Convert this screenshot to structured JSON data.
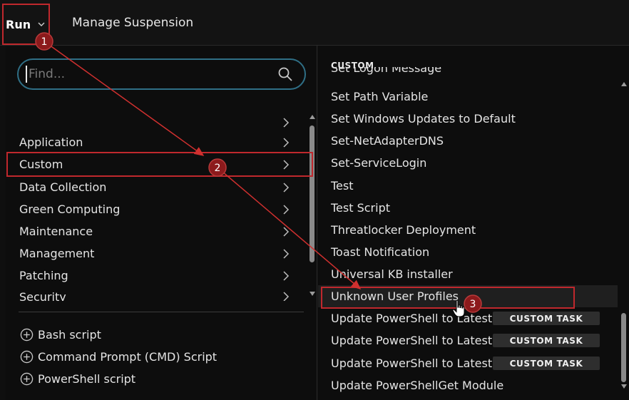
{
  "topbar": {
    "run_label": "Run",
    "run_chevron_icon": "chevron-down-icon",
    "manage_label": "Manage Suspension"
  },
  "search": {
    "placeholder": "Find...",
    "value": "",
    "icon": "search-icon"
  },
  "categories": [
    {
      "label": "",
      "icon": "chevron-right-icon"
    },
    {
      "label": "Application",
      "icon": "chevron-right-icon"
    },
    {
      "label": "Custom",
      "icon": "chevron-right-icon",
      "selected": true
    },
    {
      "label": "Data Collection",
      "icon": "chevron-right-icon"
    },
    {
      "label": "Green Computing",
      "icon": "chevron-right-icon"
    },
    {
      "label": "Maintenance",
      "icon": "chevron-right-icon"
    },
    {
      "label": "Management",
      "icon": "chevron-right-icon"
    },
    {
      "label": "Patching",
      "icon": "chevron-right-icon"
    },
    {
      "label": "Security",
      "icon": "chevron-right-icon"
    }
  ],
  "add_actions": [
    {
      "label": "Bash script",
      "icon": "plus-circle-icon"
    },
    {
      "label": "Command Prompt (CMD) Script",
      "icon": "plus-circle-icon"
    },
    {
      "label": "PowerShell script",
      "icon": "plus-circle-icon"
    }
  ],
  "right": {
    "heading": "CUSTOM",
    "clipped_top_label": "Set Logon Message",
    "items": [
      {
        "label": "Set Path Variable"
      },
      {
        "label": "Set Windows Updates to Default"
      },
      {
        "label": "Set-NetAdapterDNS"
      },
      {
        "label": "Set-ServiceLogin"
      },
      {
        "label": "Test"
      },
      {
        "label": "Test Script"
      },
      {
        "label": "Threatlocker Deployment"
      },
      {
        "label": "Toast Notification"
      },
      {
        "label": "Universal KB installer"
      },
      {
        "label": "Unknown User Profiles",
        "highlighted": true
      },
      {
        "label": "Update PowerShell to Latest...",
        "badge": "CUSTOM TASK"
      },
      {
        "label": "Update PowerShell to Latest...",
        "badge": "CUSTOM TASK"
      },
      {
        "label": "Update PowerShell to Latest...",
        "badge": "CUSTOM TASK"
      },
      {
        "label": "Update PowerShellGet Module"
      }
    ]
  },
  "annotations": {
    "step1": "1",
    "step2": "2",
    "step3": "3",
    "color": "#c0282d"
  },
  "colors": {
    "background": "#0d0d0d",
    "accent_search_border": "#2f6f86",
    "badge_bg": "#2e2e2e",
    "highlight_box": "#c0282d"
  }
}
